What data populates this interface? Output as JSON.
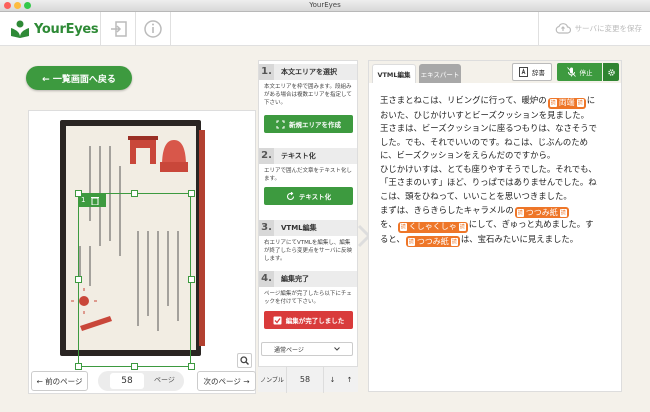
{
  "window": {
    "title": "YourEyes"
  },
  "toolbar": {
    "logo_text": "YourEyes",
    "save_label": "サーバに変更を保存"
  },
  "nav": {
    "back_label": "← 一覧画面へ戻る"
  },
  "image": {
    "selection_index": "1",
    "pager": {
      "prev_label": "← 前のページ",
      "next_label": "次のページ →",
      "page_value": "58",
      "page_unit": "ページ"
    }
  },
  "steps": [
    {
      "num": "1.",
      "title": "本文エリアを選択",
      "desc": "本文エリアを枠で囲みます。段組みがある場合は複数エリアを指定して下さい。",
      "button": "新規エリアを作成"
    },
    {
      "num": "2.",
      "title": "テキスト化",
      "desc": "エリアで囲んだ文章をテキスト化します。",
      "button": "テキスト化"
    },
    {
      "num": "3.",
      "title": "VTML編集",
      "desc": "右エリアにてVTMLを編集し、編集が終了したら変更点をサーバに反映します。",
      "button": ""
    },
    {
      "num": "4.",
      "title": "編集完了",
      "desc": "ページ編集が完了したら以下にチェックを付けて下さい。",
      "button": "編集が完了しました"
    }
  ],
  "page_type": {
    "select_value": "通常ページ",
    "nombre_label": "ノンブル",
    "nombre_value": "58",
    "down_arrow": "↓",
    "up_arrow": "↑"
  },
  "editor": {
    "tabs": [
      {
        "label": "VTML編集"
      },
      {
        "label": "エキスパート"
      }
    ],
    "dict_label": "辞書",
    "stop_label": "停止",
    "ruby_tag": "読",
    "lines": [
      {
        "a": "王さまとねこは、リビングに行って、暖炉の",
        "ruby": "両端",
        "b": "に"
      },
      {
        "a": "おいた、ひじかけいすとビーズクッションを見ました。"
      },
      {
        "a": "王さまは、ビーズクッションに座るつもりは、なさそうで"
      },
      {
        "a": "した。でも、それでいいのです。ねこは、じぶんのため"
      },
      {
        "a": "に、ビーズクッションをえらんだのですから。"
      },
      {
        "a": "ひじかけいすは、とても座りやすそうでした。それでも、"
      },
      {
        "a": "「王さまのいす」ほど、りっぱではありませんでした。ね"
      },
      {
        "a": "こは、頭をひねって、いいことを思いつきました。"
      },
      {
        "a": "まずは、きらきらしたキャラメルの",
        "ruby": "つつみ紙",
        "b": ""
      },
      {
        "a": "を、",
        "ruby": "くしゃくしゃ",
        "b": "にして、ぎゅっと丸めました。す"
      },
      {
        "a": "ると、",
        "ruby": "つつみ紙",
        "b": "は、宝石みたいに見えました。"
      }
    ]
  },
  "colors": {
    "brand_green": "#3d9a3f",
    "danger_red": "#d93b3b",
    "ruby_orange": "#ee7628"
  }
}
